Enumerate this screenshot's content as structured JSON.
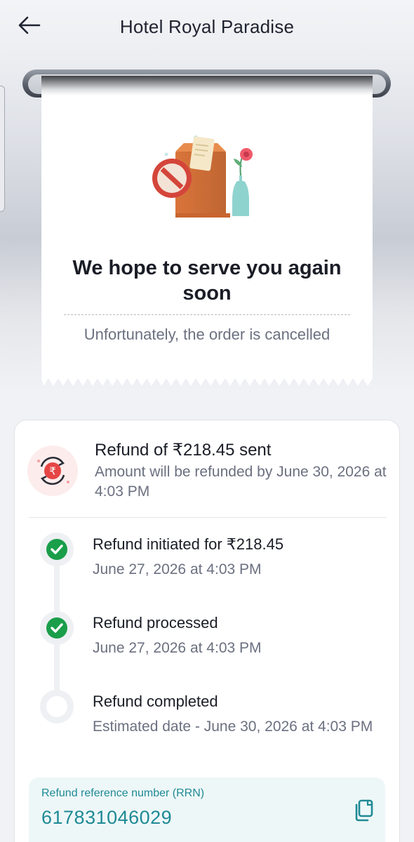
{
  "header": {
    "title": "Hotel Royal Paradise",
    "back_icon": "arrow-left-icon"
  },
  "receipt": {
    "heading": "We hope to serve you again soon",
    "subtitle": "Unfortunately, the order is cancelled",
    "illustration_icon": "cancelled-order-bag-icon"
  },
  "refund": {
    "title": "Refund of ₹218.45 sent",
    "description": "Amount will be refunded by June 30, 2026 at 4:03 PM",
    "icon": "rupee-refund-icon",
    "steps": [
      {
        "title": "Refund initiated for ₹218.45",
        "date": "June 27, 2026 at 4:03 PM",
        "status": "done"
      },
      {
        "title": "Refund processed",
        "date": "June 27, 2026 at 4:03 PM",
        "status": "done"
      },
      {
        "title": "Refund completed",
        "date": "Estimated date - June 30, 2026 at 4:03 PM",
        "status": "pending"
      }
    ]
  },
  "rrn": {
    "label": "Refund reference number (RRN)",
    "value": "617831046029",
    "copy_icon": "copy-icon"
  },
  "colors": {
    "success": "#1a9e4a",
    "accent_teal": "#1f8a95",
    "rrn_bg": "#eef7f8",
    "muted_text": "#6b7080"
  }
}
